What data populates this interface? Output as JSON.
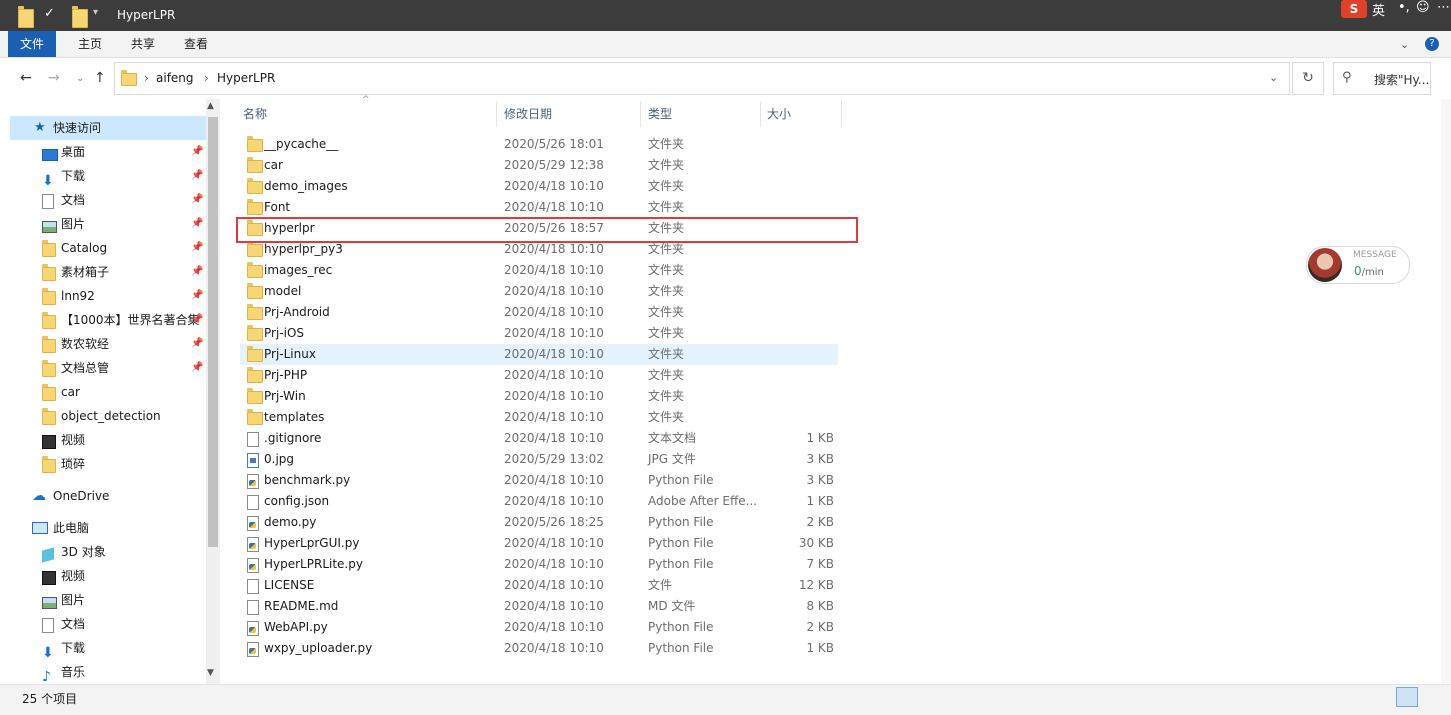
{
  "window": {
    "title": "HyperLPR",
    "tray": {
      "sogou": "S",
      "lang": "英",
      "punct": "•,",
      "emoji": "☺",
      "more": "⋯"
    }
  },
  "ribbon": {
    "tabs": [
      {
        "label": "文件",
        "active": true
      },
      {
        "label": "主页"
      },
      {
        "label": "共享"
      },
      {
        "label": "查看"
      }
    ]
  },
  "address": {
    "crumbs": [
      "aifeng",
      "HyperLPR"
    ],
    "separator": "›"
  },
  "search": {
    "placeholder": "搜索\"Hy..."
  },
  "nav": {
    "quick_access": "快速访问",
    "items": [
      {
        "label": "桌面",
        "icon": "desktop-icon",
        "pinned": true
      },
      {
        "label": "下载",
        "icon": "download-icon",
        "pinned": true
      },
      {
        "label": "文档",
        "icon": "document-icon",
        "pinned": true
      },
      {
        "label": "图片",
        "icon": "picture-icon",
        "pinned": true
      },
      {
        "label": "Catalog",
        "icon": "folder-icon",
        "pinned": true
      },
      {
        "label": "素材箱子",
        "icon": "folder-icon",
        "pinned": true
      },
      {
        "label": "lnn92",
        "icon": "folder-icon",
        "pinned": true
      },
      {
        "label": "【1000本】世界名著合集",
        "icon": "folder-icon",
        "pinned": true
      },
      {
        "label": "数农软经",
        "icon": "folder-icon",
        "pinned": true
      },
      {
        "label": "文档总管",
        "icon": "folder-icon",
        "pinned": true
      },
      {
        "label": "car",
        "icon": "folder-icon",
        "pinned": false
      },
      {
        "label": "object_detection",
        "icon": "folder-icon",
        "pinned": false
      },
      {
        "label": "视频",
        "icon": "video-icon",
        "pinned": false
      },
      {
        "label": "琐碎",
        "icon": "folder-icon",
        "pinned": false
      }
    ],
    "onedrive": "OneDrive",
    "this_pc": "此电脑",
    "pc_items": [
      {
        "label": "3D 对象",
        "icon": "3d-objects-icon"
      },
      {
        "label": "视频",
        "icon": "video-icon"
      },
      {
        "label": "图片",
        "icon": "picture-icon"
      },
      {
        "label": "文档",
        "icon": "document-icon"
      },
      {
        "label": "下载",
        "icon": "download-icon"
      },
      {
        "label": "音乐",
        "icon": "music-icon"
      }
    ]
  },
  "columns": {
    "name": "名称",
    "date": "修改日期",
    "type": "类型",
    "size": "大小"
  },
  "files": [
    {
      "name": "__pycache__",
      "date": "2020/5/26 18:01",
      "type": "文件夹",
      "size": "",
      "icon": "folder"
    },
    {
      "name": "car",
      "date": "2020/5/29 12:38",
      "type": "文件夹",
      "size": "",
      "icon": "folder"
    },
    {
      "name": "demo_images",
      "date": "2020/4/18 10:10",
      "type": "文件夹",
      "size": "",
      "icon": "folder"
    },
    {
      "name": "Font",
      "date": "2020/4/18 10:10",
      "type": "文件夹",
      "size": "",
      "icon": "folder"
    },
    {
      "name": "hyperlpr",
      "date": "2020/5/26 18:57",
      "type": "文件夹",
      "size": "",
      "icon": "folder",
      "highlighted": true
    },
    {
      "name": "hyperlpr_py3",
      "date": "2020/4/18 10:10",
      "type": "文件夹",
      "size": "",
      "icon": "folder"
    },
    {
      "name": "images_rec",
      "date": "2020/4/18 10:10",
      "type": "文件夹",
      "size": "",
      "icon": "folder"
    },
    {
      "name": "model",
      "date": "2020/4/18 10:10",
      "type": "文件夹",
      "size": "",
      "icon": "folder"
    },
    {
      "name": "Prj-Android",
      "date": "2020/4/18 10:10",
      "type": "文件夹",
      "size": "",
      "icon": "folder"
    },
    {
      "name": "Prj-iOS",
      "date": "2020/4/18 10:10",
      "type": "文件夹",
      "size": "",
      "icon": "folder"
    },
    {
      "name": "Prj-Linux",
      "date": "2020/4/18 10:10",
      "type": "文件夹",
      "size": "",
      "icon": "folder",
      "hover": true
    },
    {
      "name": "Prj-PHP",
      "date": "2020/4/18 10:10",
      "type": "文件夹",
      "size": "",
      "icon": "folder"
    },
    {
      "name": "Prj-Win",
      "date": "2020/4/18 10:10",
      "type": "文件夹",
      "size": "",
      "icon": "folder"
    },
    {
      "name": "templates",
      "date": "2020/4/18 10:10",
      "type": "文件夹",
      "size": "",
      "icon": "folder"
    },
    {
      "name": ".gitignore",
      "date": "2020/4/18 10:10",
      "type": "文本文档",
      "size": "1 KB",
      "icon": "doc"
    },
    {
      "name": "0.jpg",
      "date": "2020/5/29 13:02",
      "type": "JPG 文件",
      "size": "3 KB",
      "icon": "img"
    },
    {
      "name": "benchmark.py",
      "date": "2020/4/18 10:10",
      "type": "Python File",
      "size": "3 KB",
      "icon": "py"
    },
    {
      "name": "config.json",
      "date": "2020/4/18 10:10",
      "type": "Adobe After Effe...",
      "size": "1 KB",
      "icon": "doc"
    },
    {
      "name": "demo.py",
      "date": "2020/5/26 18:25",
      "type": "Python File",
      "size": "2 KB",
      "icon": "py"
    },
    {
      "name": "HyperLprGUI.py",
      "date": "2020/4/18 10:10",
      "type": "Python File",
      "size": "30 KB",
      "icon": "py"
    },
    {
      "name": "HyperLPRLite.py",
      "date": "2020/4/18 10:10",
      "type": "Python File",
      "size": "7 KB",
      "icon": "py"
    },
    {
      "name": "LICENSE",
      "date": "2020/4/18 10:10",
      "type": "文件",
      "size": "12 KB",
      "icon": "doc"
    },
    {
      "name": "README.md",
      "date": "2020/4/18 10:10",
      "type": "MD 文件",
      "size": "8 KB",
      "icon": "doc"
    },
    {
      "name": "WebAPI.py",
      "date": "2020/4/18 10:10",
      "type": "Python File",
      "size": "2 KB",
      "icon": "py"
    },
    {
      "name": "wxpy_uploader.py",
      "date": "2020/4/18 10:10",
      "type": "Python File",
      "size": "1 KB",
      "icon": "py"
    }
  ],
  "message_widget": {
    "label": "MESSAGE",
    "count": "0",
    "unit": "/min"
  },
  "status": {
    "count": "25 个项目"
  }
}
